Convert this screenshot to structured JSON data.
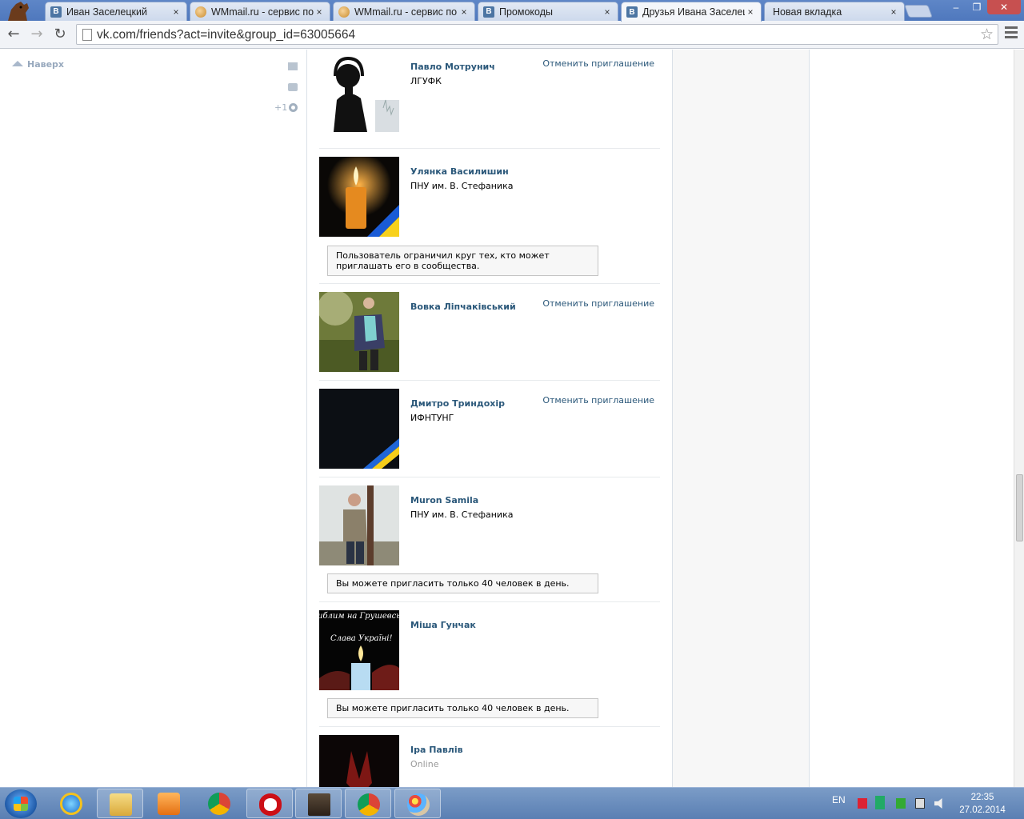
{
  "browser": {
    "tabs": [
      {
        "title": "Иван Заселецкий",
        "favicon": "vk-icon"
      },
      {
        "title": "WMmail.ru - сервис по",
        "favicon": "wmmail-icon"
      },
      {
        "title": "WMmail.ru - сервис по",
        "favicon": "wmmail-icon"
      },
      {
        "title": "Промокоды",
        "favicon": "vk-icon"
      },
      {
        "title": "Друзья Ивана Заселец",
        "favicon": "vk-icon",
        "active": true
      },
      {
        "title": "Новая вкладка",
        "favicon": ""
      }
    ],
    "close_glyph": "×",
    "url": "vk.com/friends?act=invite&group_id=63005664",
    "window_buttons": [
      "–",
      "❐",
      "✕"
    ]
  },
  "sidebar": {
    "to_top_label": "Наверх",
    "plus_one": "+1"
  },
  "friends": [
    {
      "name": "Павло Мотрунич",
      "subtitle": "ЛГУФК",
      "action": "Отменить приглашение",
      "notice": ""
    },
    {
      "name": "Улянка Василишин",
      "subtitle": "ПНУ им. В. Стефаника",
      "action": "",
      "notice": "Пользователь ограничил круг тех, кто может приглашать его в сообщества."
    },
    {
      "name": "Вовка Ліпчаківський",
      "subtitle": "",
      "action": "Отменить приглашение",
      "notice": ""
    },
    {
      "name": "Дмитро Триндохір",
      "subtitle": "ИФНТУНГ",
      "action": "Отменить приглашение",
      "notice": ""
    },
    {
      "name": "Muron Samila",
      "subtitle": "ПНУ им. В. Стефаника",
      "action": "",
      "notice": "Вы можете пригласить только 40 человек в день."
    },
    {
      "name": "Міша Гунчак",
      "subtitle": "",
      "action": "",
      "notice": "Вы можете пригласить только 40 человек в день.",
      "avatar_text": [
        "иблим на Грушевсько",
        "Слава Україні!"
      ]
    },
    {
      "name": "Іра Павлів",
      "subtitle": "Online",
      "action": "",
      "notice": ""
    }
  ],
  "taskbar": {
    "language": "EN",
    "time": "22:35",
    "date": "27.02.2014"
  },
  "colors": {
    "link": "#2b587a",
    "taskbar": "#5a7fb3"
  }
}
